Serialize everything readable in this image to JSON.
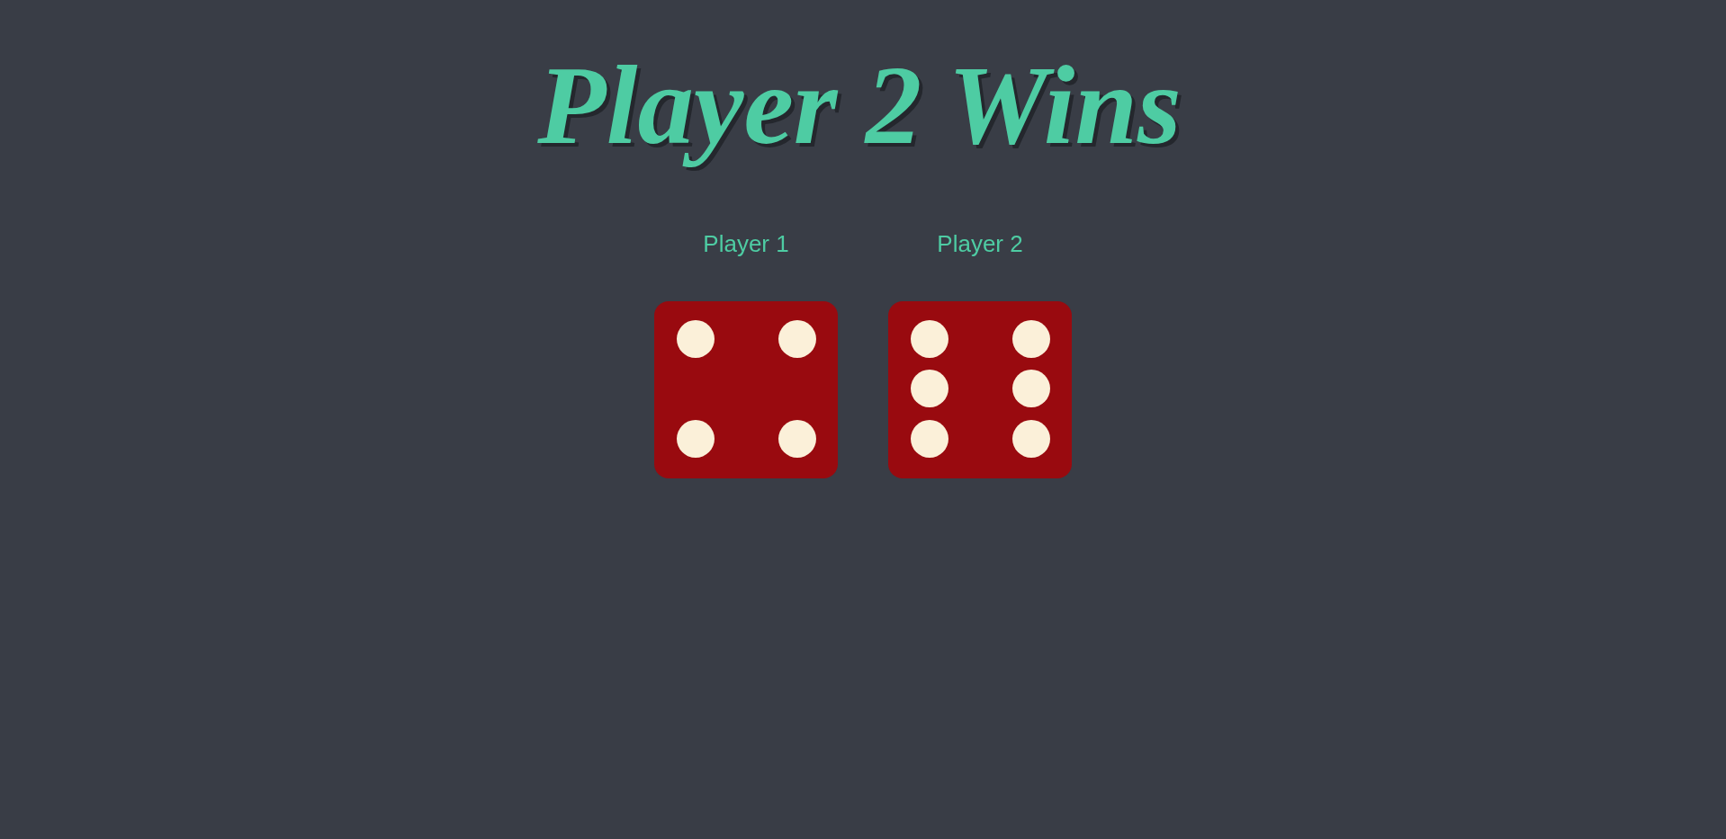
{
  "title": "Player 2 Wins",
  "players": [
    {
      "label": "Player 1",
      "die": {
        "kind": "four"
      }
    },
    {
      "label": "Player 2",
      "die": {
        "kind": "six"
      }
    }
  ]
}
